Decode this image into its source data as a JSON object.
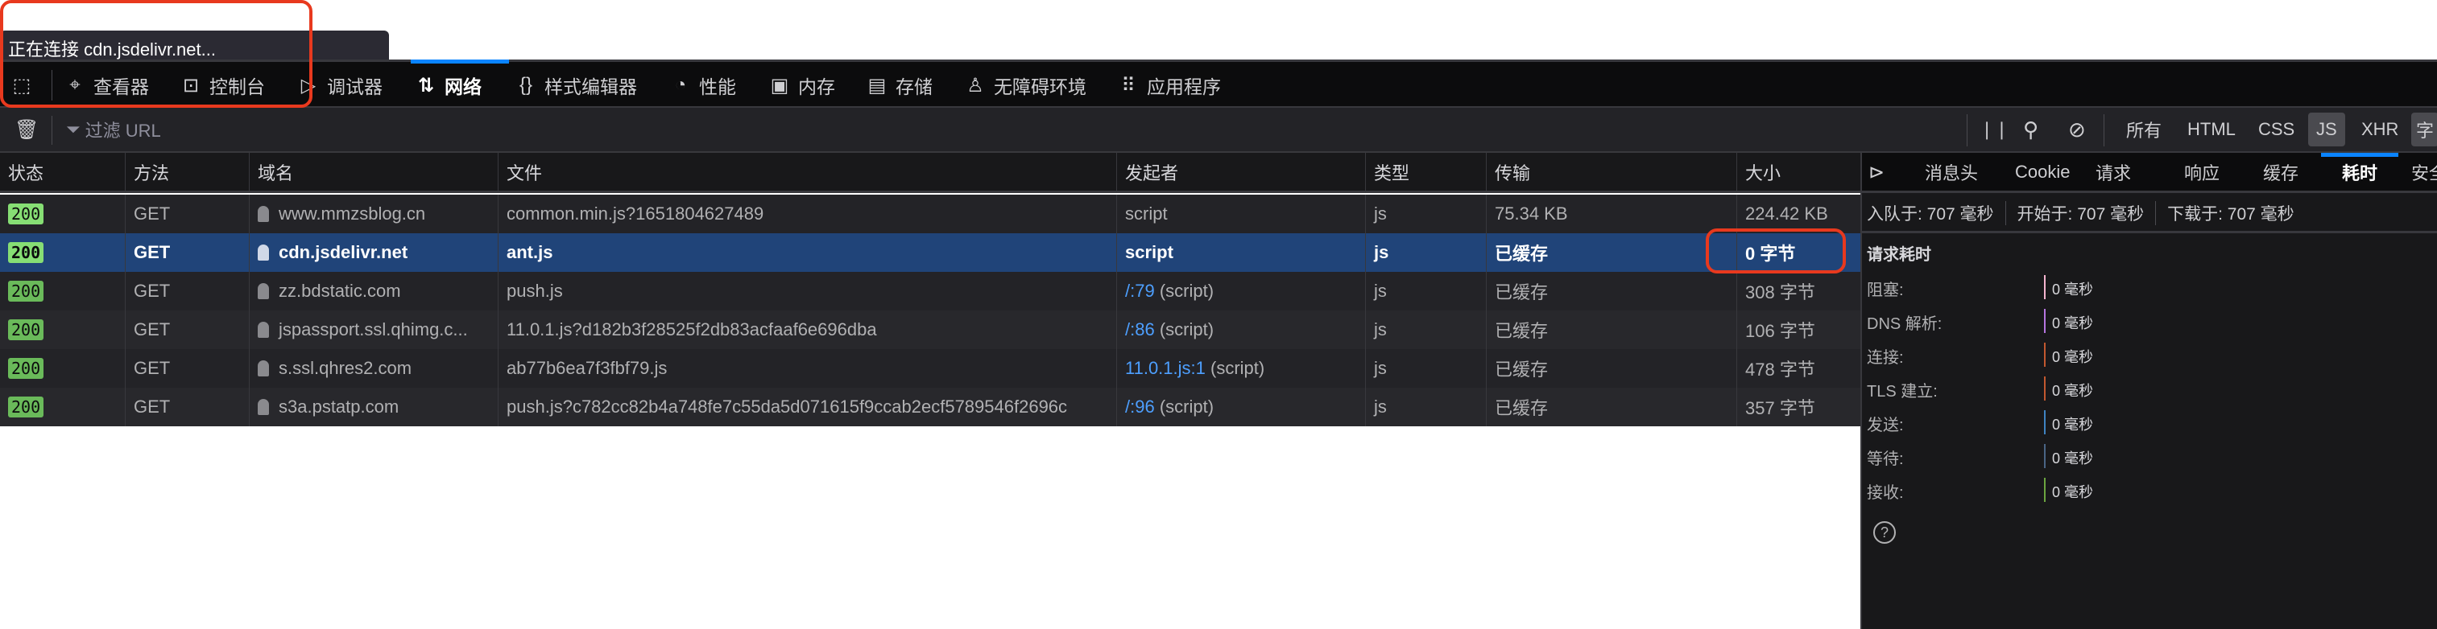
{
  "tab": {
    "title": "正在连接 cdn.jsdelivr.net..."
  },
  "toolbar": {
    "items": [
      {
        "label": "查看器",
        "icon": "inspector-icon"
      },
      {
        "label": "控制台",
        "icon": "console-icon"
      },
      {
        "label": "调试器",
        "icon": "debugger-icon"
      },
      {
        "label": "网络",
        "icon": "network-icon",
        "active": true
      },
      {
        "label": "样式编辑器",
        "icon": "style-editor-icon"
      },
      {
        "label": "性能",
        "icon": "performance-icon"
      },
      {
        "label": "内存",
        "icon": "memory-icon"
      },
      {
        "label": "存储",
        "icon": "storage-icon"
      },
      {
        "label": "无障碍环境",
        "icon": "accessibility-icon"
      },
      {
        "label": "应用程序",
        "icon": "application-icon"
      }
    ]
  },
  "filter": {
    "placeholder": "过滤 URL",
    "types": [
      "所有",
      "HTML",
      "CSS",
      "JS",
      "XHR",
      "字"
    ],
    "active_type": "JS"
  },
  "table": {
    "headers": [
      "状态",
      "方法",
      "域名",
      "文件",
      "发起者",
      "类型",
      "传输",
      "大小"
    ],
    "rows": [
      {
        "status": "200",
        "method": "GET",
        "domain": "www.mmzsblog.cn",
        "file": "common.min.js?1651804627489",
        "initiator_link": "",
        "initiator": "script",
        "type": "js",
        "transfer": "75.34 KB",
        "size": "224.42 KB"
      },
      {
        "status": "200",
        "method": "GET",
        "domain": "cdn.jsdelivr.net",
        "file": "ant.js",
        "initiator_link": "",
        "initiator": "script",
        "type": "js",
        "transfer": "已缓存",
        "size": "0 字节",
        "selected": true
      },
      {
        "status": "200",
        "method": "GET",
        "domain": "zz.bdstatic.com",
        "file": "push.js",
        "initiator_link": "/:79",
        "initiator": "(script)",
        "type": "js",
        "transfer": "已缓存",
        "size": "308 字节"
      },
      {
        "status": "200",
        "method": "GET",
        "domain": "jspassport.ssl.qhimg.c...",
        "file": "11.0.1.js?d182b3f28525f2db83acfaaf6e696dba",
        "initiator_link": "/:86",
        "initiator": "(script)",
        "type": "js",
        "transfer": "已缓存",
        "size": "106 字节"
      },
      {
        "status": "200",
        "method": "GET",
        "domain": "s.ssl.qhres2.com",
        "file": "ab77b6ea7f3fbf79.js",
        "initiator_link": "11.0.1.js:1",
        "initiator": "(script)",
        "type": "js",
        "transfer": "已缓存",
        "size": "478 字节"
      },
      {
        "status": "200",
        "method": "GET",
        "domain": "s3a.pstatp.com",
        "file": "push.js?c782cc82b4a748fe7c55da5d071615f9ccab2ecf5789546f2696c",
        "initiator_link": "/:96",
        "initiator": "(script)",
        "type": "js",
        "transfer": "已缓存",
        "size": "357 字节"
      }
    ]
  },
  "details": {
    "tabs": [
      "消息头",
      "Cookie",
      "请求",
      "响应",
      "缓存",
      "耗时",
      "安全"
    ],
    "active_tab": "耗时",
    "summary": [
      "入队于: 707 毫秒",
      "开始于: 707 毫秒",
      "下载于: 707 毫秒"
    ],
    "section_title": "请求耗时",
    "timings": [
      {
        "label": "阻塞:",
        "value": "0 毫秒",
        "color": "#f5b4cf"
      },
      {
        "label": "DNS 解析:",
        "value": "0 毫秒",
        "color": "#b675e0"
      },
      {
        "label": "连接:",
        "value": "0 毫秒",
        "color": "#c2582f"
      },
      {
        "label": "TLS 建立:",
        "value": "0 毫秒",
        "color": "#c2582f"
      },
      {
        "label": "发送:",
        "value": "0 毫秒",
        "color": "#3f83c2"
      },
      {
        "label": "等待:",
        "value": "0 毫秒",
        "color": "#4a6585"
      },
      {
        "label": "接收:",
        "value": "0 毫秒",
        "color": "#6ca540"
      }
    ]
  }
}
